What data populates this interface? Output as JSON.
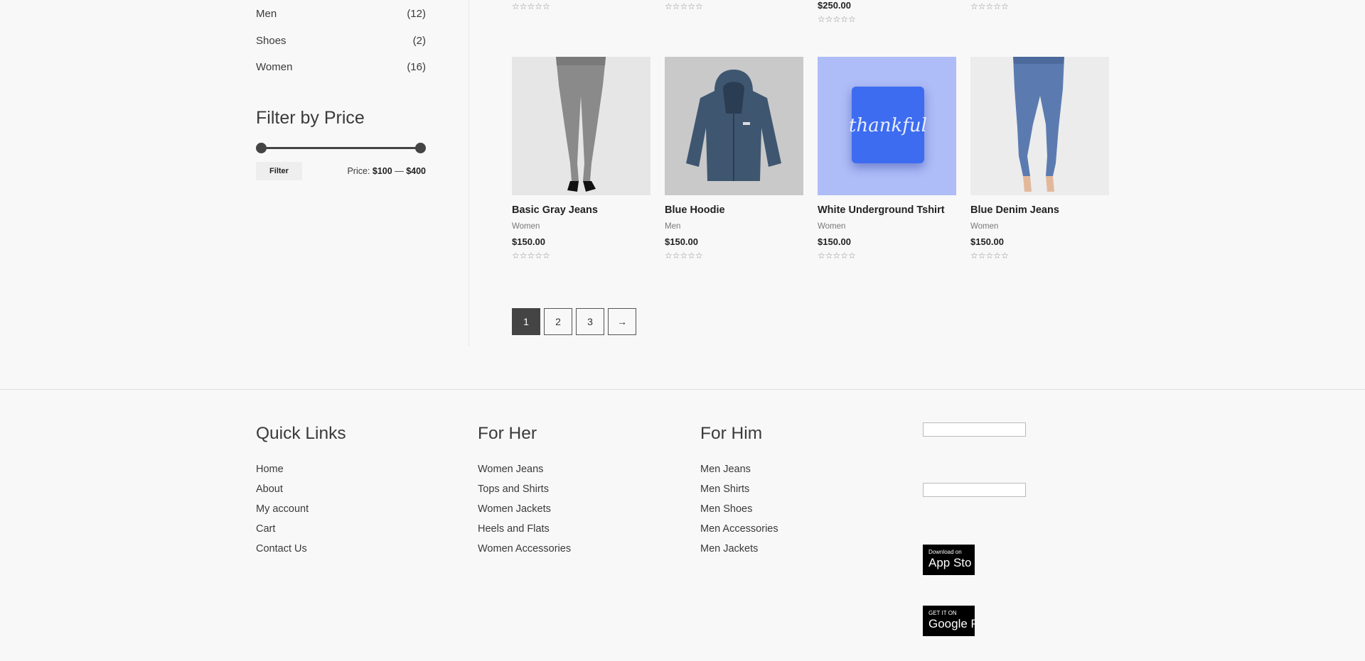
{
  "sidebar": {
    "categories": [
      {
        "name": "Men",
        "count": "(12)"
      },
      {
        "name": "Shoes",
        "count": "(2)"
      },
      {
        "name": "Women",
        "count": "(16)"
      }
    ],
    "filter_title": "Filter by Price",
    "filter_button": "Filter",
    "price_prefix": "Price:",
    "price_min": "$100",
    "price_sep": "—",
    "price_max": "$400"
  },
  "top_row": {
    "stars": "☆☆☆☆☆",
    "price_3": "$250.00"
  },
  "products": [
    {
      "title": "Basic Gray Jeans",
      "category": "Women",
      "price": "$150.00",
      "stars": "☆☆☆☆☆"
    },
    {
      "title": "Blue Hoodie",
      "category": "Men",
      "price": "$150.00",
      "stars": "☆☆☆☆☆"
    },
    {
      "title": "White Underground Tshirt",
      "category": "Women",
      "price": "$150.00",
      "stars": "☆☆☆☆☆",
      "shirt_text": "thankful"
    },
    {
      "title": "Blue Denim Jeans",
      "category": "Women",
      "price": "$150.00",
      "stars": "☆☆☆☆☆"
    }
  ],
  "pagination": [
    "1",
    "2",
    "3",
    "→"
  ],
  "footer": {
    "quick_links": {
      "title": "Quick Links",
      "links": [
        "Home",
        "About",
        "My account",
        "Cart",
        "Contact Us"
      ]
    },
    "for_her": {
      "title": "For Her",
      "links": [
        "Women Jeans",
        "Tops and Shirts",
        "Women Jackets",
        "Heels and Flats",
        "Women Accessories"
      ]
    },
    "for_him": {
      "title": "For Him",
      "links": [
        "Men Jeans",
        "Men Shirts",
        "Men Shoes",
        "Men Accessories",
        "Men Jackets"
      ]
    },
    "app_store": {
      "line1": "Download on",
      "line2": "App Sto"
    },
    "google_play": {
      "line1": "GET IT ON",
      "line2": "Google P"
    }
  },
  "colors": {
    "background": "#f8f8f8",
    "active_page": "#444444",
    "tshirt": "#3d6cf0"
  }
}
